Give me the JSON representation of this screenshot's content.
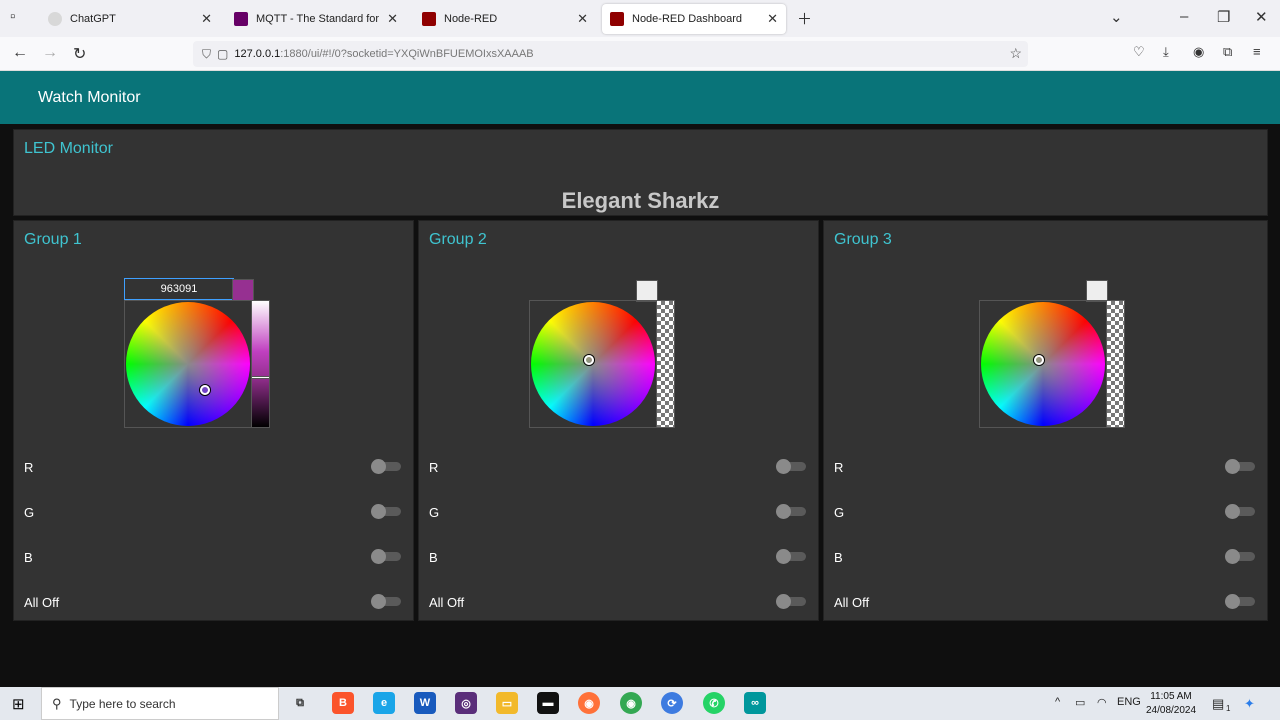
{
  "browser": {
    "tabs": [
      {
        "title": "ChatGPT",
        "color": "#d8d8d8"
      },
      {
        "title": "MQTT - The Standard for IoT M",
        "color": "#660066"
      },
      {
        "title": "Node-RED",
        "color": "#8f0000"
      },
      {
        "title": "Node-RED Dashboard",
        "color": "#8f0000"
      }
    ],
    "url_host": "127.0.0.1",
    "url_rest": ":1880/ui/#!/0?socketid=YXQiWnBFUEMOIxsXAAAB"
  },
  "dashboard": {
    "title": "Watch Monitor",
    "led_card": {
      "title": "LED Monitor",
      "text": "Elegant Sharkz"
    },
    "groups": [
      {
        "title": "Group 1",
        "hex": "963091",
        "selected_color": "#963091",
        "rows": [
          {
            "label": "R",
            "on": false
          },
          {
            "label": "G",
            "on": false
          },
          {
            "label": "B",
            "on": false
          },
          {
            "label": "All Off",
            "on": false
          }
        ]
      },
      {
        "title": "Group 2",
        "selected_color": "#eeeeee",
        "rows": [
          {
            "label": "R",
            "on": false
          },
          {
            "label": "G",
            "on": false
          },
          {
            "label": "B",
            "on": false
          },
          {
            "label": "All Off",
            "on": false
          }
        ]
      },
      {
        "title": "Group 3",
        "selected_color": "#eeeeee",
        "rows": [
          {
            "label": "R",
            "on": false
          },
          {
            "label": "G",
            "on": false
          },
          {
            "label": "B",
            "on": false
          },
          {
            "label": "All Off",
            "on": false
          }
        ]
      }
    ],
    "accent_color": "#3fc4d0",
    "header_color": "#097479"
  },
  "taskbar": {
    "search_placeholder": "Type here to search",
    "language": "ENG",
    "time": "11:05 AM",
    "date": "24/08/2024",
    "notification_count": "1"
  }
}
